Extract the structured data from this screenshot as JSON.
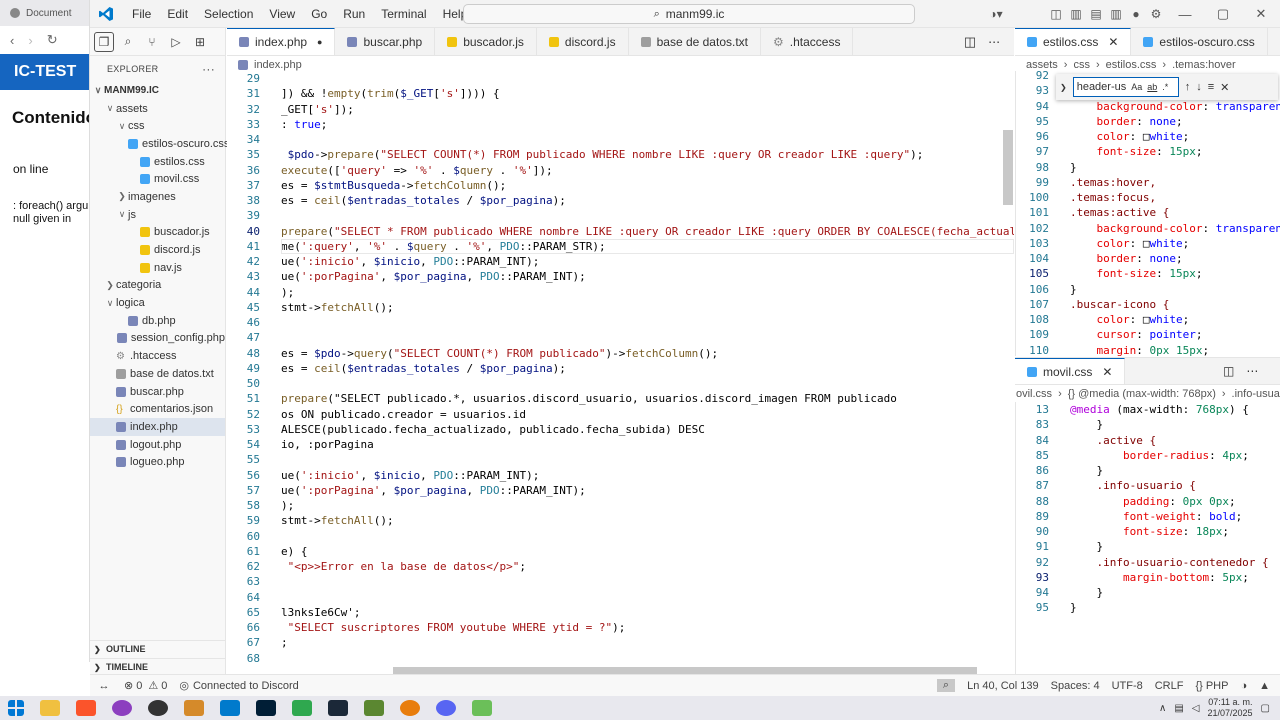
{
  "browser": {
    "tab_title": "Document",
    "brand": "IC-TEST",
    "heading": "Contenido",
    "status": "on line",
    "error_line1": ": foreach() argum",
    "error_line2": "null given in"
  },
  "titlebar": {
    "menus": [
      "File",
      "Edit",
      "Selection",
      "View",
      "Go",
      "Run",
      "Terminal",
      "Help"
    ],
    "search": "manm99.ic"
  },
  "explorer": {
    "title": "EXPLORER",
    "more": "···",
    "root": "MANM99.IC",
    "tree": [
      {
        "label": "assets",
        "depth": 1,
        "type": "folder-open"
      },
      {
        "label": "css",
        "depth": 2,
        "type": "folder-open"
      },
      {
        "label": "estilos-oscuro.css",
        "depth": 3,
        "type": "css"
      },
      {
        "label": "estilos.css",
        "depth": 3,
        "type": "css"
      },
      {
        "label": "movil.css",
        "depth": 3,
        "type": "css"
      },
      {
        "label": "imagenes",
        "depth": 2,
        "type": "folder"
      },
      {
        "label": "js",
        "depth": 2,
        "type": "folder-open"
      },
      {
        "label": "buscador.js",
        "depth": 3,
        "type": "js"
      },
      {
        "label": "discord.js",
        "depth": 3,
        "type": "js"
      },
      {
        "label": "nav.js",
        "depth": 3,
        "type": "js"
      },
      {
        "label": "categoria",
        "depth": 1,
        "type": "folder"
      },
      {
        "label": "logica",
        "depth": 1,
        "type": "folder-open"
      },
      {
        "label": "db.php",
        "depth": 2,
        "type": "php"
      },
      {
        "label": "session_config.php",
        "depth": 2,
        "type": "php"
      },
      {
        "label": ".htaccess",
        "depth": 1,
        "type": "gear"
      },
      {
        "label": "base de datos.txt",
        "depth": 1,
        "type": "txt"
      },
      {
        "label": "buscar.php",
        "depth": 1,
        "type": "php"
      },
      {
        "label": "comentarios.json",
        "depth": 1,
        "type": "json"
      },
      {
        "label": "index.php",
        "depth": 1,
        "type": "php",
        "selected": true
      },
      {
        "label": "logout.php",
        "depth": 1,
        "type": "php"
      },
      {
        "label": "logueo.php",
        "depth": 1,
        "type": "php"
      }
    ],
    "outline": "OUTLINE",
    "timeline": "TIMELINE"
  },
  "main_tabs": [
    {
      "label": "index.php",
      "active": true,
      "dirty": true,
      "icon": "php"
    },
    {
      "label": "buscar.php",
      "icon": "php"
    },
    {
      "label": "buscador.js",
      "icon": "js"
    },
    {
      "label": "discord.js",
      "icon": "js"
    },
    {
      "label": "base de datos.txt",
      "icon": "txt"
    },
    {
      "label": ".htaccess",
      "icon": "gear"
    }
  ],
  "main_breadcrumb": "index.php",
  "main_code": {
    "lines": [
      29,
      31,
      32,
      33,
      34,
      35,
      36,
      37,
      38,
      39,
      40,
      41,
      42,
      43,
      44,
      45,
      46,
      47,
      48,
      49,
      50,
      51,
      52,
      53,
      54,
      55,
      56,
      57,
      58,
      59,
      60,
      61,
      62,
      63,
      64,
      65,
      66,
      67,
      68
    ],
    "current_line": 40,
    "code": [
      "",
      "]) && !empty(trim($_GET['s']))) {",
      "_GET['s']);",
      ": true;",
      "",
      " $pdo->prepare(\"SELECT COUNT(*) FROM publicado WHERE nombre LIKE :query OR creador LIKE :query\");",
      "execute(['query' => '%' . $query . '%']);",
      "es = $stmtBusqueda->fetchColumn();",
      "es = ceil($entradas_totales / $por_pagina);",
      "",
      "prepare(\"SELECT * FROM publicado WHERE nombre LIKE :query OR creador LIKE :query ORDER BY COALESCE(fecha_actualizado\")",
      "me(':query', '%' . $query . '%', PDO::PARAM_STR);",
      "ue(':inicio', $inicio, PDO::PARAM_INT);",
      "ue(':porPagina', $por_pagina, PDO::PARAM_INT);",
      ");",
      "stmt->fetchAll();",
      "",
      "",
      "es = $pdo->query(\"SELECT COUNT(*) FROM publicado\")->fetchColumn();",
      "es = ceil($entradas_totales / $por_pagina);",
      "",
      "prepare(\"SELECT publicado.*, usuarios.discord_usuario, usuarios.discord_imagen FROM publicado",
      "os ON publicado.creador = usuarios.id",
      "ALESCE(publicado.fecha_actualizado, publicado.fecha_subida) DESC",
      "io, :porPagina",
      "",
      "ue(':inicio', $inicio, PDO::PARAM_INT);",
      "ue(':porPagina', $por_pagina, PDO::PARAM_INT);",
      ");",
      "stmt->fetchAll();",
      "",
      "e) {",
      " \"<p>>Error en la base de datos</p>\";",
      "",
      "",
      "l3nksIe6Cw';",
      " \"SELECT suscriptores FROM youtube WHERE ytid = ?\");",
      ";"
    ]
  },
  "right_tabs_top": [
    {
      "label": "estilos.css",
      "active": true
    },
    {
      "label": "estilos-oscuro.css"
    }
  ],
  "right_breadcrumb_top": [
    "assets",
    "css",
    "estilos.css",
    ".temas:hover"
  ],
  "find_widget": {
    "value": "header-us",
    "aa": "Aa",
    "ab": "ab",
    "regex": ".*"
  },
  "css_top": {
    "lines": [
      92,
      93,
      94,
      95,
      96,
      97,
      98,
      99,
      100,
      101,
      102,
      103,
      104,
      105,
      106,
      107,
      108,
      109,
      110
    ],
    "current_line": 105,
    "code": [
      "",
      "",
      "    background-color: transparent",
      "    border: none;",
      "    color: □white;",
      "    font-size: 15px;",
      "}",
      ".temas:hover,",
      ".temas:focus,",
      ".temas:active {",
      "    background-color: transparent",
      "    color: □white;",
      "    border: none;",
      "    font-size: 15px;",
      "}",
      ".buscar-icono {",
      "    color: □white;",
      "    cursor: pointer;",
      "    margin: 0px 15px;"
    ]
  },
  "right_tabs_bottom": [
    {
      "label": "movil.css",
      "active": true
    }
  ],
  "right_breadcrumb_bottom": [
    "ovil.css",
    "{} @media (max-width: 768px)",
    ".info-usuar"
  ],
  "css_bottom": {
    "lines": [
      13,
      83,
      84,
      85,
      86,
      87,
      88,
      89,
      90,
      91,
      92,
      93,
      94,
      95
    ],
    "current_line": 93,
    "code": [
      "@media (max-width: 768px) {",
      "    }",
      "    .active {",
      "        border-radius: 4px;",
      "    }",
      "    .info-usuario {",
      "        padding: 0px 0px;",
      "        font-weight: bold;",
      "        font-size: 18px;",
      "    }",
      "    .info-usuario-contenedor {",
      "        margin-bottom: 5px;",
      "    }",
      "}"
    ]
  },
  "statusbar": {
    "errors": "0",
    "warnings": "0",
    "discord": "Connected to Discord",
    "position": "Ln 40, Col 139",
    "spaces": "Spaces: 4",
    "encoding": "UTF-8",
    "eol": "CRLF",
    "lang": "PHP"
  },
  "taskbar": {
    "time": "07:11 a. m.",
    "date": "21/07/2025"
  },
  "colors": {
    "accent": "#005fb8",
    "php": "#7a86b8",
    "css": "#42a5f5",
    "js": "#f1c40f",
    "json": "#f1c40f",
    "folder": "#90a4ae"
  }
}
